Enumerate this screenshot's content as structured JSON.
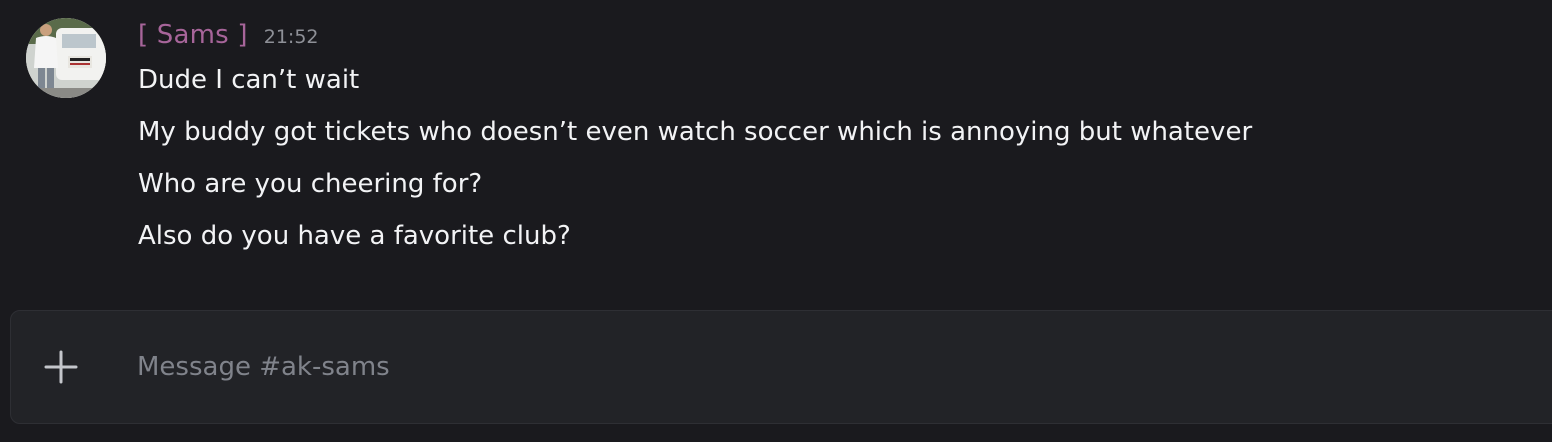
{
  "message": {
    "author": "[ Sams ]",
    "timestamp": "21:52",
    "author_color": "#a7659a",
    "lines": [
      "Dude I can’t wait",
      "My buddy got tickets who doesn’t even watch soccer which is annoying but whatever",
      "Who are you cheering for?",
      "Also do you have a favorite club?"
    ]
  },
  "composer": {
    "add_icon": "plus-icon",
    "placeholder": "Message #ak-sams",
    "value": ""
  }
}
